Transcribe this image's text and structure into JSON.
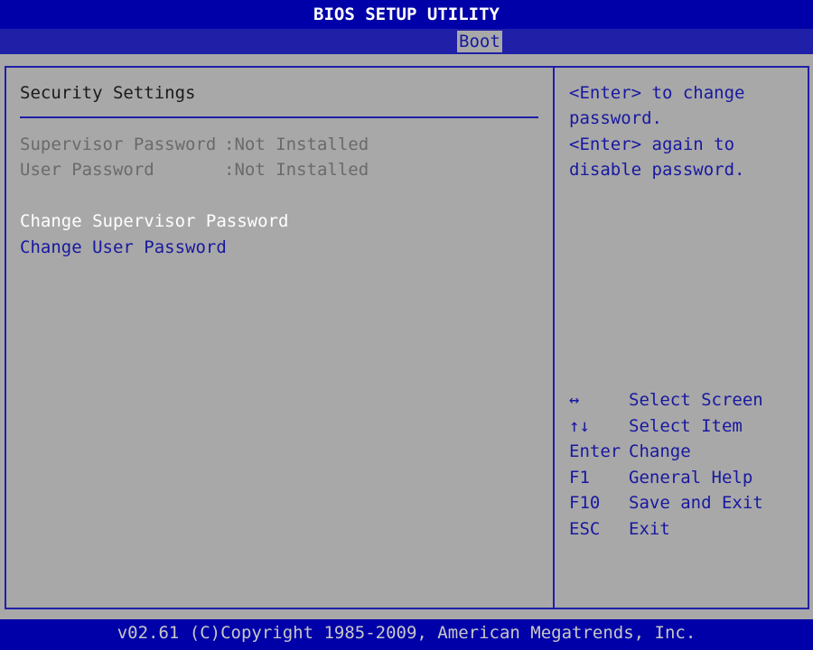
{
  "header": {
    "title": "BIOS SETUP UTILITY",
    "active_tab": "Boot"
  },
  "main": {
    "section_title": "Security Settings",
    "password_status": [
      {
        "label": "Supervisor Password",
        "value": ":Not Installed"
      },
      {
        "label": "User Password",
        "value": ":Not Installed"
      }
    ],
    "menu_items": [
      {
        "label": "Change Supervisor Password",
        "selected": true
      },
      {
        "label": "Change User Password",
        "selected": false
      }
    ]
  },
  "help": {
    "lines": [
      "<Enter> to change",
      "password.",
      "<Enter> again to",
      "disable password."
    ],
    "keys": [
      {
        "key": "↔",
        "action": "Select Screen"
      },
      {
        "key": "↑↓",
        "action": "Select Item"
      },
      {
        "key": "Enter",
        "action": "Change"
      },
      {
        "key": "F1",
        "action": "General Help"
      },
      {
        "key": "F10",
        "action": "Save and Exit"
      },
      {
        "key": "ESC",
        "action": "Exit"
      }
    ]
  },
  "footer": {
    "copyright": "v02.61 (C)Copyright 1985-2009, American Megatrends, Inc."
  },
  "colors": {
    "title_bg": "#0000a8",
    "panel_bg": "#a8a8a8",
    "highlight_text": "#ffffff",
    "menu_text": "#1818a0",
    "disabled_text": "#6a6a6a"
  }
}
